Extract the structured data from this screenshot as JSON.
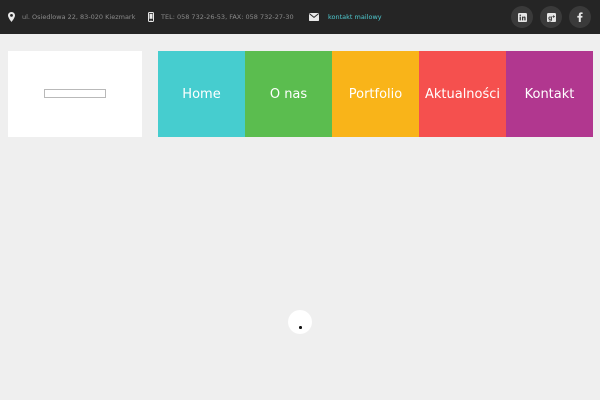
{
  "topbar": {
    "address": "ul. Osiedlowa 22, 83-020 Kiezmark",
    "phone": "TEL: 058 732-26-53, FAX: 058 732-27-30",
    "email_link": "kontakt mailowy"
  },
  "social": {
    "linkedin_label": "in",
    "googleplus_label": "g+",
    "facebook_label": "f"
  },
  "nav": {
    "items": [
      {
        "label": "Home",
        "color": "#46cdcf"
      },
      {
        "label": "O nas",
        "color": "#5bbd4f"
      },
      {
        "label": "Portfolio",
        "color": "#f9b419"
      },
      {
        "label": "Aktualności",
        "color": "#f5504e"
      },
      {
        "label": "Kontakt",
        "color": "#b1378f"
      }
    ]
  },
  "icons": {
    "address": "map-marker-icon",
    "phone": "mobile-phone-icon",
    "email": "envelope-icon"
  }
}
